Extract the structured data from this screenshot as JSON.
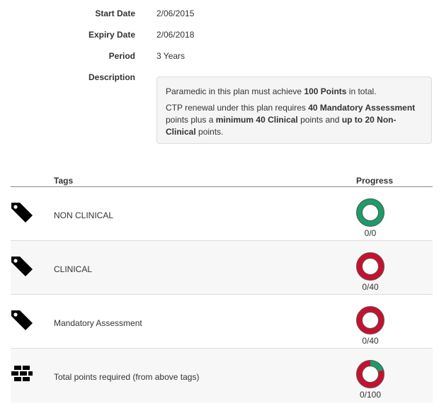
{
  "plan": {
    "start_date_label": "Start Date",
    "start_date_value": "2/06/2015",
    "expiry_date_label": "Expiry Date",
    "expiry_date_value": "2/06/2018",
    "period_label": "Period",
    "period_value": "3 Years",
    "description_label": "Description",
    "description": {
      "p1_a": "Paramedic in this plan must achieve ",
      "p1_b": "100 Points",
      "p1_c": " in total.",
      "p2_a": "CTP renewal under this plan requires ",
      "p2_b": "40 Mandatory Assessment",
      "p2_c": " points plus a ",
      "p2_d": "minimum 40 Clinical",
      "p2_e": " points and ",
      "p2_f": "up to 20 Non-Clinical",
      "p2_g": " points."
    }
  },
  "table": {
    "headers": {
      "tags": "Tags",
      "progress": "Progress"
    },
    "rows": [
      {
        "icon": "tag-icon",
        "label": "NON CLINICAL",
        "count": "0/0",
        "progress": 1.0,
        "fill_color": "#1a9c6b"
      },
      {
        "icon": "tag-icon",
        "label": "CLINICAL",
        "count": "0/40",
        "progress": 0.0,
        "fill_color": "#1a9c6b"
      },
      {
        "icon": "tag-icon",
        "label": "Mandatory Assessment",
        "count": "0/40",
        "progress": 0.0,
        "fill_color": "#1a9c6b"
      },
      {
        "icon": "bricks-icon",
        "label": "Total points required (from above tags)",
        "count": "0/100",
        "progress": 0.2,
        "fill_color": "#1a9c6b"
      }
    ]
  },
  "colors": {
    "complete": "#1a9c6b",
    "incomplete": "#c8102e",
    "ring_border": "#555555"
  }
}
